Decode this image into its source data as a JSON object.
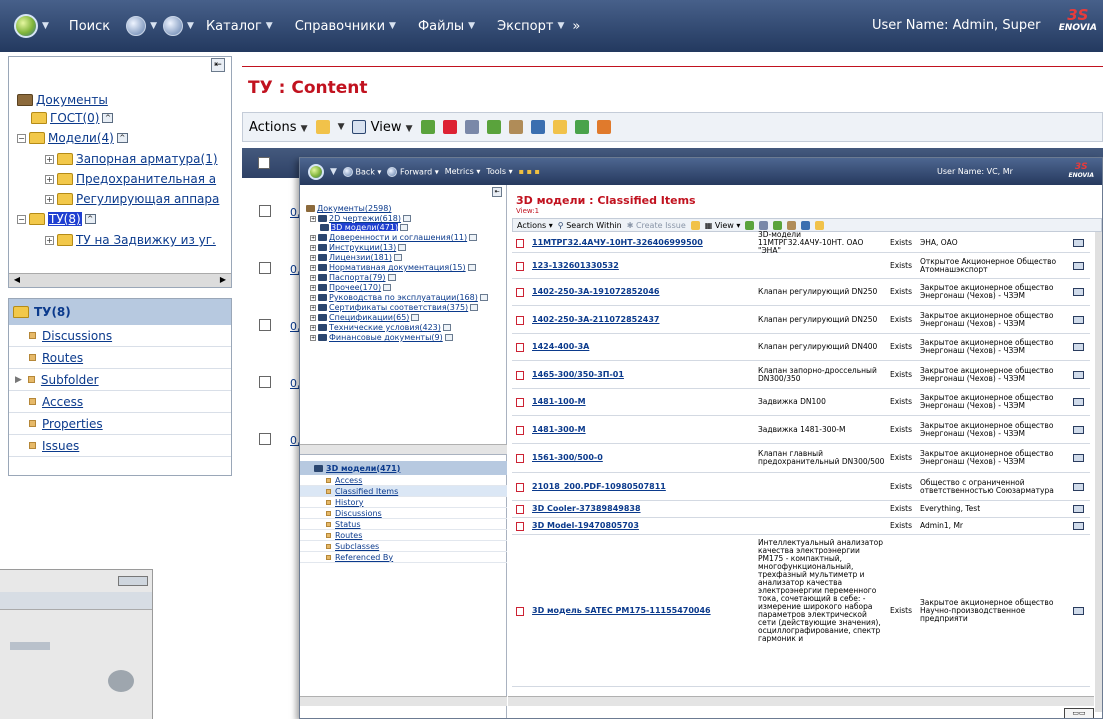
{
  "topbar": {
    "search": "Поиск",
    "menus": [
      "Каталог",
      "Справочники",
      "Файлы",
      "Экспорт"
    ],
    "more": "»",
    "user": "User Name: Admin, Super",
    "brand": "ENOVIA"
  },
  "tree": {
    "nodes": [
      {
        "label": "Документы",
        "depth": 0
      },
      {
        "label": "ГОСТ(0)",
        "depth": 1
      },
      {
        "label": "Модели(4)",
        "depth": 1
      },
      {
        "label": "Запорная арматура(1)",
        "depth": 2
      },
      {
        "label": "Предохранительная а",
        "depth": 2
      },
      {
        "label": "Регулирующая аппара",
        "depth": 2
      },
      {
        "label": "ТУ(8)",
        "depth": 1
      },
      {
        "label": "ТУ на Задвижку из уг.",
        "depth": 2
      }
    ]
  },
  "nav": {
    "head": "ТУ(8)",
    "items": [
      "Discussions",
      "Routes",
      "Subfolder",
      "Access",
      "Properties",
      "Issues"
    ]
  },
  "main": {
    "title": "ТУ : Content",
    "actions": "Actions",
    "view": "View",
    "row_links": [
      "0,",
      "0,",
      "0,",
      "0,",
      "0,"
    ]
  },
  "win": {
    "back": "Back",
    "forward": "Forward",
    "metrics": "Metrics",
    "tools": "Tools",
    "user": "User Name: VC, Mr",
    "brand": "ENOVIA",
    "tree": [
      {
        "label": "Документы(2598)",
        "depth": 0
      },
      {
        "label": "2D чертежи(618)",
        "depth": 1
      },
      {
        "label": "3D модели(471)",
        "depth": 1,
        "selected": true
      },
      {
        "label": "Доверенности и соглашения(11)",
        "depth": 1
      },
      {
        "label": "Инструкции(13)",
        "depth": 1
      },
      {
        "label": "Лицензии(181)",
        "depth": 1
      },
      {
        "label": "Нормативная документация(15)",
        "depth": 1
      },
      {
        "label": "Паспорта(79)",
        "depth": 1
      },
      {
        "label": "Прочее(170)",
        "depth": 1
      },
      {
        "label": "Руководства по эксплуатации(168)",
        "depth": 1
      },
      {
        "label": "Сертификаты соответствия(375)",
        "depth": 1
      },
      {
        "label": "Спецификации(65)",
        "depth": 1
      },
      {
        "label": "Технические условия(423)",
        "depth": 1
      },
      {
        "label": "Финансовые документы(9)",
        "depth": 1
      }
    ],
    "nav_head": "3D модели(471)",
    "nav_items": [
      "Access",
      "Classified Items",
      "History",
      "Discussions",
      "Status",
      "Routes",
      "Subclasses",
      "Referenced By"
    ],
    "nav_selected": 1,
    "title": "3D модели : Classified Items",
    "view": "View:1",
    "toolbar": {
      "actions": "Actions",
      "search": "Search Within",
      "create": "Create Issue",
      "view": "View"
    },
    "rows": [
      {
        "name": "11МТРГ32.4АЧУ-10НТ-326406999500",
        "desc": "3D-модели 11МТРГ32.4АЧУ-10НТ. ОАО \"ЭНА\"",
        "status": "Exists",
        "owner": "ЭНА, ОАО"
      },
      {
        "name": "123-132601330532",
        "desc": "",
        "status": "Exists",
        "owner": "Открытое Акционерное Общество Атомнашэкспорт"
      },
      {
        "name": "1402-250-3А-191072852046",
        "desc": "Клапан регулирующий DN250",
        "status": "Exists",
        "owner": "Закрытое акционерное общество Энергонаш (Чехов) - ЧЗЭМ"
      },
      {
        "name": "1402-250-3А-211072852437",
        "desc": "Клапан регулирующий DN250",
        "status": "Exists",
        "owner": "Закрытое акционерное общество Энергонаш (Чехов) - ЧЗЭМ"
      },
      {
        "name": "1424-400-3А",
        "desc": "Клапан регулирующий DN400",
        "status": "Exists",
        "owner": "Закрытое акционерное общество Энергонаш (Чехов) - ЧЗЭМ"
      },
      {
        "name": "1465-300/350-3П-01",
        "desc": "Клапан запорно-дроссельный DN300/350",
        "status": "Exists",
        "owner": "Закрытое акционерное общество Энергонаш (Чехов) - ЧЗЭМ"
      },
      {
        "name": "1481-100-М",
        "desc": "Задвижка DN100",
        "status": "Exists",
        "owner": "Закрытое акционерное общество Энергонаш (Чехов) - ЧЗЭМ"
      },
      {
        "name": "1481-300-М",
        "desc": "Задвижка 1481-300-М",
        "status": "Exists",
        "owner": "Закрытое акционерное общество Энергонаш (Чехов) - ЧЗЭМ"
      },
      {
        "name": "1561-300/500-0",
        "desc": "Клапан главный предохранительный DN300/500",
        "status": "Exists",
        "owner": "Закрытое акционерное общество Энергонаш (Чехов) - ЧЗЭМ"
      },
      {
        "name": "21018_200.PDF-10980507811",
        "desc": "",
        "status": "Exists",
        "owner": "Общество с ограниченной ответственностью Союзарматура"
      },
      {
        "name": "3D Cooler-37389849838",
        "desc": "",
        "status": "Exists",
        "owner": "Everything, Test"
      },
      {
        "name": "3D Model-19470805703",
        "desc": "",
        "status": "Exists",
        "owner": "Admin1, Mr"
      },
      {
        "name": "3D модель SATEC PM175-11155470046",
        "desc": "Интеллектуальный анализатор качества электроэнергии PM175 - компактный, многофункциональный, трехфазный мультиметр и анализатор качества электроэнергии переменного тока, сочетающий в себе: - измерение широкого набора параметров электрической сети (действующие значения), осциллографирование, спектр гармоник и",
        "status": "Exists",
        "owner": "Закрытое акционерное общество Научно-производственное предприяти"
      }
    ]
  }
}
